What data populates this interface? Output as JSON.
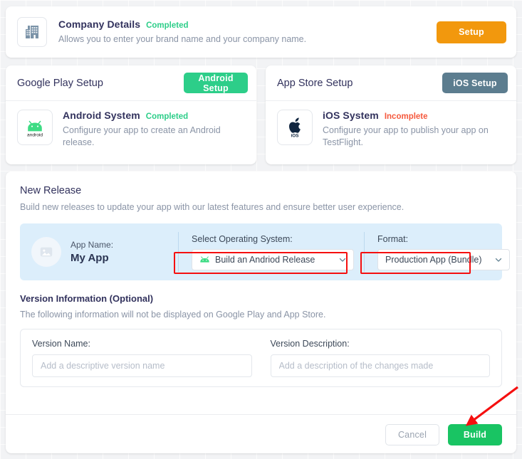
{
  "company": {
    "icon": "building-icon",
    "title": "Company Details",
    "status": "Completed",
    "description": "Allows you to enter your brand name and your company name.",
    "action_label": "Setup",
    "action_color": "#f2980d"
  },
  "google_play": {
    "heading": "Google Play Setup",
    "action_label": "Android Setup",
    "action_color": "#2dce89",
    "icon": "android-icon",
    "icon_caption": "android",
    "item_title": "Android System",
    "item_status": "Completed",
    "item_status_color": "#2dce89",
    "item_description": "Configure your app to create an Android release."
  },
  "app_store": {
    "heading": "App Store Setup",
    "action_label": "iOS Setup",
    "action_color": "#5c7d8f",
    "icon": "apple-icon",
    "icon_caption": "iOS",
    "item_title": "iOS System",
    "item_status": "Incomplete",
    "item_status_color": "#f5593d",
    "item_description": "Configure your app to publish your app on TestFlight."
  },
  "new_release": {
    "heading": "New Release",
    "description": "Build new releases to update your app with our latest features and ensure better user experience.",
    "app_name_label": "App Name:",
    "app_name_value": "My App",
    "app_icon": "image-placeholder-icon",
    "os_label": "Select Operating System:",
    "os_value": "Build an Andriod Release",
    "format_label": "Format:",
    "format_value": "Production App (Bundle)",
    "highlight_color": "#f50f0f"
  },
  "version_info": {
    "heading": "Version Information (Optional)",
    "description": "The following information will not be displayed on Google Play and App Store.",
    "name_label": "Version Name:",
    "name_value": "",
    "name_placeholder": "Add a descriptive version name",
    "desc_label": "Version Description:",
    "desc_value": "",
    "desc_placeholder": "Add a description of the changes made"
  },
  "footer": {
    "cancel_label": "Cancel",
    "build_label": "Build",
    "build_color": "#19c463"
  },
  "annotation": {
    "arrow_color": "#f50f0f",
    "target": "build-button"
  }
}
